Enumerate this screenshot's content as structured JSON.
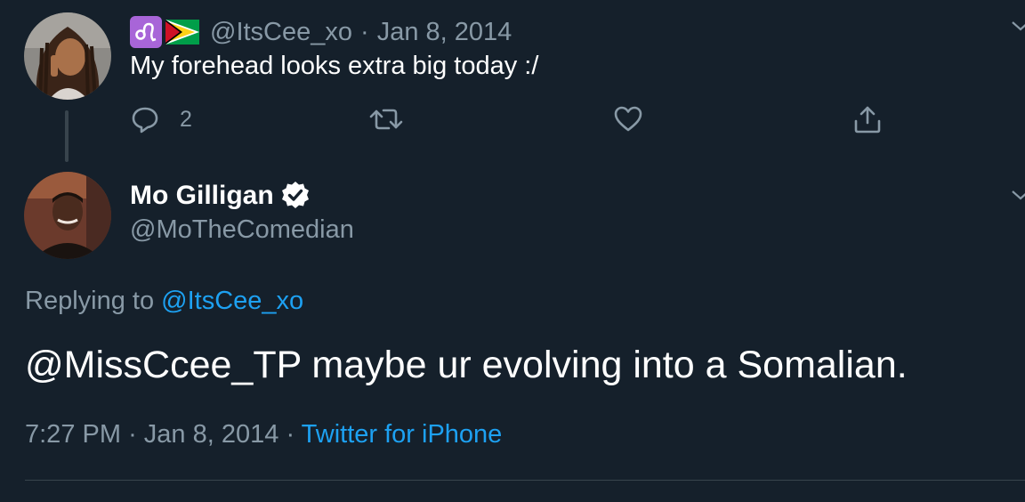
{
  "parent_tweet": {
    "handle": "@ItsCee_xo",
    "separator": "·",
    "date": "Jan 8, 2014",
    "text": "My forehead looks extra big today :/",
    "reply_count": "2",
    "badge_emoji": "leo-zodiac-icon",
    "flag_emoji": "guyana-flag-icon"
  },
  "reply_tweet": {
    "name": "Mo Gilligan",
    "handle": "@MoTheComedian",
    "replying_label": "Replying to",
    "replying_to": "@ItsCee_xo",
    "text": "@MissCcee_TP maybe ur evolving into a Somalian.",
    "time": "7:27 PM",
    "separator": "·",
    "date": "Jan 8, 2014",
    "separator2": "·",
    "source": "Twitter for iPhone"
  },
  "colors": {
    "background": "#15202b",
    "primary_text": "#ffffff",
    "secondary_text": "#8899a6",
    "link": "#1da1f2",
    "divider": "#38444d"
  }
}
